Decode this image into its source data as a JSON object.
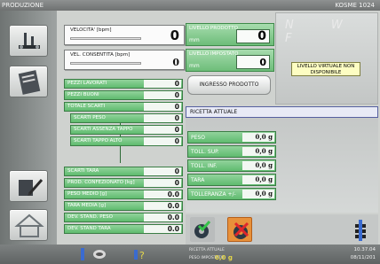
{
  "titlebar": {
    "app": "PRODUZIONE",
    "device": "KOSME 1024"
  },
  "speed": {
    "velocita_label": "VELOCITA' [bpm]",
    "velocita_value": "0",
    "consentita_label": "VEL. CONSENTITA [bpm]",
    "consentita_value": "0"
  },
  "levels": {
    "prodotto_label": "LIVELLO PRODOTTO",
    "prodotto_unit": "mm",
    "prodotto_value": "0",
    "impostato_label": "LIVELLO IMPOSTATO",
    "impostato_unit": "mm",
    "impostato_value": "0",
    "ingresso_button": "INGRESSO PRODOTTO",
    "nwf_letters": "N W F",
    "virtual_note": "LIVELLO VIRTUALE NON DISPONIBILE"
  },
  "counters": [
    {
      "label": "PEZZI LAVORATI",
      "value": "0"
    },
    {
      "label": "PEZZI BUONI",
      "value": "0"
    },
    {
      "label": "TOTALE SCARTI",
      "value": "0"
    },
    {
      "label": "SCARTI PESO",
      "value": "0"
    },
    {
      "label": "SCARTI ASSENZA TAPPO",
      "value": "0"
    },
    {
      "label": "SCARTI TAPPO ALTO",
      "value": "0"
    },
    {
      "label": "SCARTI TARA",
      "value": "0"
    },
    {
      "label": "PROD. CONFEZIONATO [kg]",
      "value": "0"
    },
    {
      "label": "PESO MEDIO [g]",
      "value": "0.0"
    },
    {
      "label": "TARA MEDIA [g]",
      "value": "0.0"
    },
    {
      "label": "DEV. STAND. PESO",
      "value": "0.0"
    },
    {
      "label": "DEV. STAND TARA",
      "value": "0.0"
    }
  ],
  "recipe": {
    "title": "RICETTA ATTUALE",
    "rows": [
      {
        "label": "PESO",
        "value": "0,0 g"
      },
      {
        "label": "TOLL. SUP.",
        "value": "0,0 g"
      },
      {
        "label": "TOLL. INF.",
        "value": "0,0 g"
      },
      {
        "label": "TARA",
        "value": "0,0 g"
      },
      {
        "label": "TOLLERANZA +/-",
        "value": "0,0 g"
      }
    ]
  },
  "statusbar": {
    "ricetta_label": "RICETTA ATTUALE",
    "peso_label": "PESO IMPOSTATO",
    "peso_value": "0,0 g",
    "time": "10.37.04",
    "date": "08/11/201"
  },
  "colors": {
    "green_panel": "#5fbb6f",
    "status_yellow": "#e6d84a",
    "virtual_note_bg": "#fdfdc2"
  }
}
